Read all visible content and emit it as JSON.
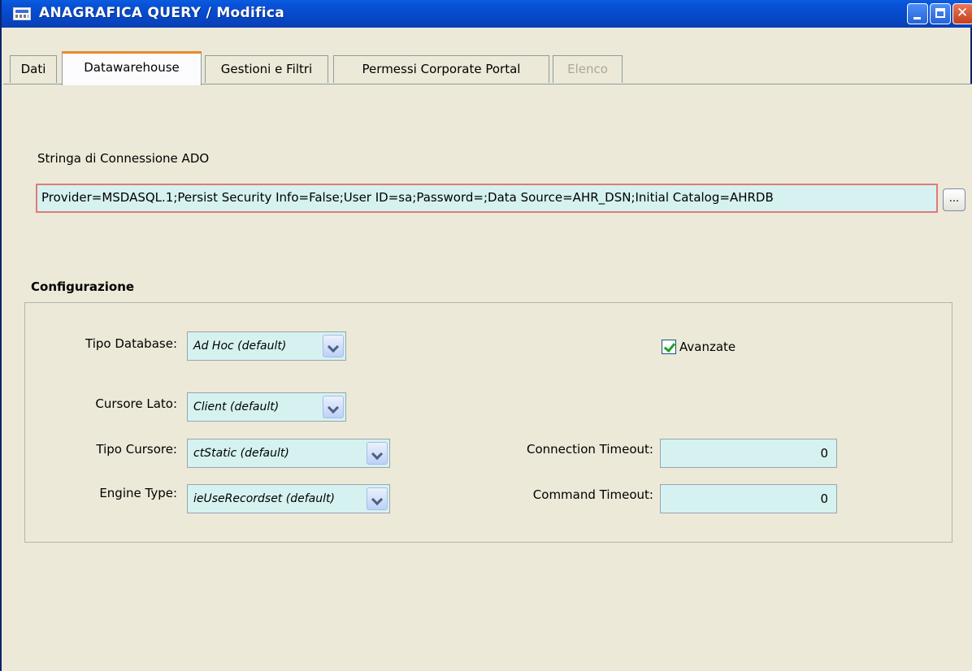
{
  "window": {
    "title": "ANAGRAFICA QUERY / Modifica",
    "buttons": [
      "minimize",
      "maximize",
      "close"
    ]
  },
  "tabs": [
    {
      "label": "Dati",
      "active": false,
      "enabled": true
    },
    {
      "label": "Datawarehouse",
      "active": true,
      "enabled": true
    },
    {
      "label": "Gestioni e Filtri",
      "active": false,
      "enabled": true
    },
    {
      "label": "Permessi Corporate Portal",
      "active": false,
      "enabled": true
    },
    {
      "label": "Elenco",
      "active": false,
      "enabled": false
    }
  ],
  "connection": {
    "label": "Stringa di Connessione ADO",
    "value": "Provider=MSDASQL.1;Persist Security Info=False;User ID=sa;Password=;Data Source=AHR_DSN;Initial Catalog=AHRDB",
    "browse_label": "..."
  },
  "config": {
    "title": "Configurazione",
    "tipo_database": {
      "label": "Tipo Database:",
      "value": "Ad Hoc (default)"
    },
    "cursore_lato": {
      "label": "Cursore Lato:",
      "value": "Client (default)"
    },
    "tipo_cursore": {
      "label": "Tipo Cursore:",
      "value": "ctStatic (default)"
    },
    "engine_type": {
      "label": "Engine Type:",
      "value": "ieUseRecordset (default)"
    },
    "avanzate": {
      "label": "Avanzate",
      "checked": true
    },
    "connection_timeout": {
      "label": "Connection Timeout:",
      "value": "0"
    },
    "command_timeout": {
      "label": "Command Timeout:",
      "value": "0"
    }
  },
  "colors": {
    "titlebar": "#0a5ce0",
    "input_bg": "#d5f2f0",
    "active_tab_accent": "#e68b2c",
    "window_bg": "#ece9d8"
  }
}
